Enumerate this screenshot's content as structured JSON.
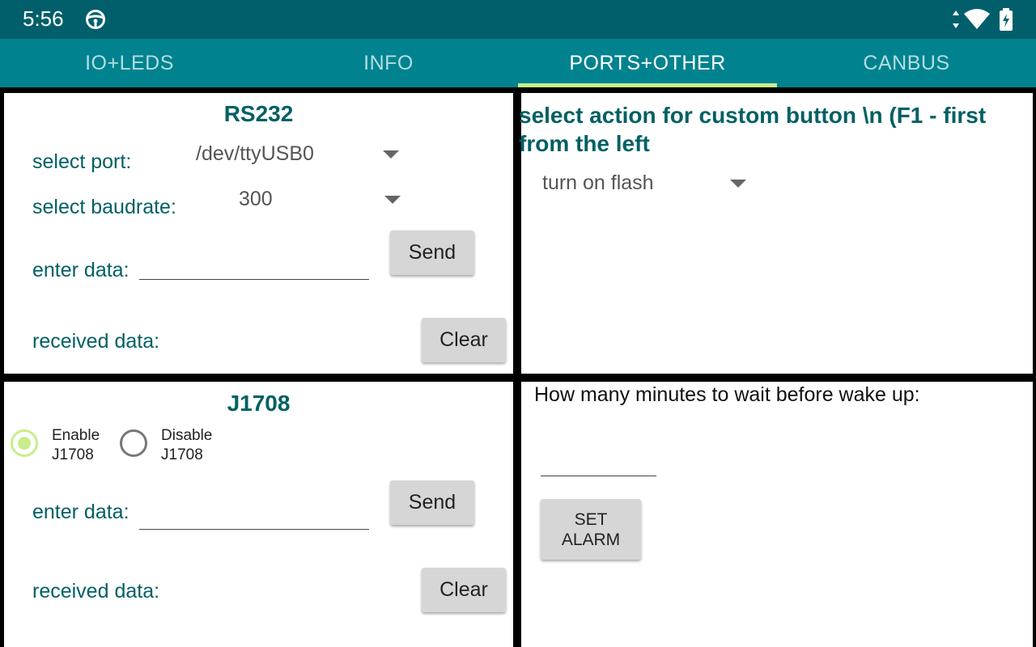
{
  "status_bar": {
    "time": "5:56",
    "app_icon": "steering-wheel-icon",
    "icons": [
      "data-arrows-icon",
      "wifi-icon",
      "battery-charging-icon"
    ]
  },
  "tabs": [
    {
      "label": "IO+LEDS",
      "active": false
    },
    {
      "label": "INFO",
      "active": false
    },
    {
      "label": "PORTS+OTHER",
      "active": true
    },
    {
      "label": "CANBUS",
      "active": false
    }
  ],
  "rs232": {
    "title": "RS232",
    "port_label": "select port:",
    "port_value": "/dev/ttyUSB0",
    "baud_label": "select baudrate:",
    "baud_value": "300",
    "enter_label": "enter data:",
    "enter_value": "",
    "send_label": "Send",
    "received_label": "received data:",
    "clear_label": "Clear"
  },
  "custom_button": {
    "title": "select action for custom button \\n (F1 - first from the left",
    "action_value": "turn on flash"
  },
  "j1708": {
    "title": "J1708",
    "enable_label": "Enable J1708",
    "disable_label": "Disable J1708",
    "enabled": true,
    "enter_label": "enter data:",
    "enter_value": "",
    "send_label": "Send",
    "received_label": "received data:",
    "clear_label": "Clear"
  },
  "alarm": {
    "question": "How many minutes to wait before wake up:",
    "minutes_value": "",
    "set_label": "SET ALARM"
  },
  "colors": {
    "status_bar": "#005f6b",
    "tab_bar": "#00838f",
    "accent": "#c6ee8a",
    "label_text": "#006064"
  }
}
